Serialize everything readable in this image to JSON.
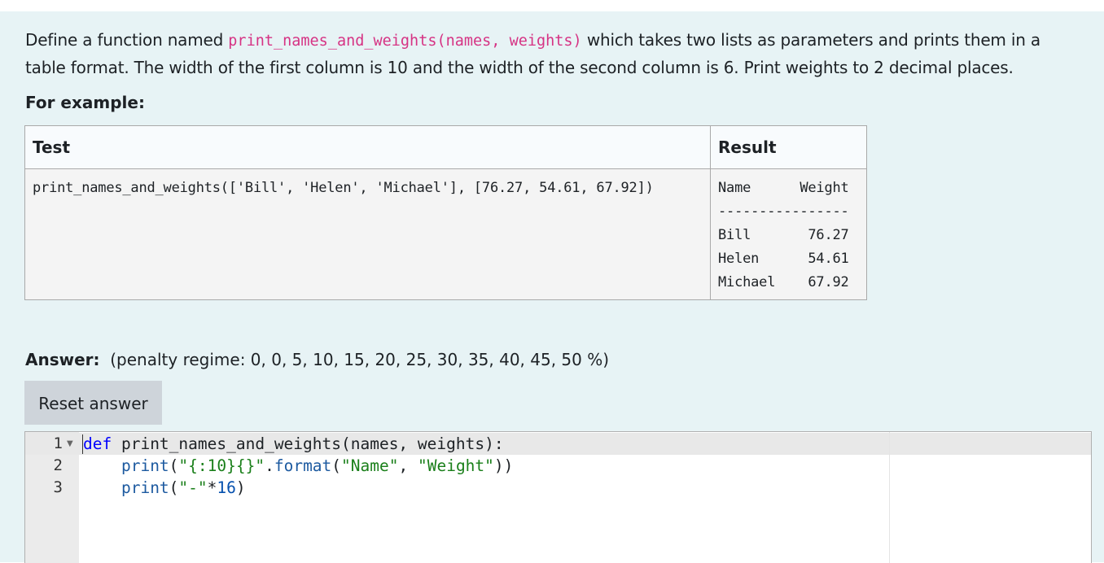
{
  "question": {
    "text_before": "Define a function named ",
    "code_signature": "print_names_and_weights(names, weights)",
    "text_after": " which takes two lists as parameters and prints them in a table format. The width of the first column is 10 and the width of the second column is 6. Print weights to 2 decimal places.",
    "for_example_label": "For example:"
  },
  "examples_table": {
    "headers": [
      "Test",
      "Result"
    ],
    "rows": [
      {
        "test": "print_names_and_weights(['Bill', 'Helen', 'Michael'], [76.27, 54.61, 67.92])",
        "result": "Name      Weight\n----------------\nBill       76.27\nHelen      54.61\nMichael    67.92"
      }
    ]
  },
  "answer": {
    "label": "Answer:",
    "penalty": "(penalty regime: 0, 0, 5, 10, 15, 20, 25, 30, 35, 40, 45, 50 %)",
    "reset_label": "Reset answer"
  },
  "editor": {
    "line_numbers": [
      "1",
      "2",
      "3"
    ],
    "fold_icon": "triangle-down-icon",
    "lines": [
      "def print_names_and_weights(names, weights):",
      "    print(\"{:10}{}\".format(\"Name\", \"Weight\"))",
      "    print(\"-\"*16)"
    ]
  }
}
